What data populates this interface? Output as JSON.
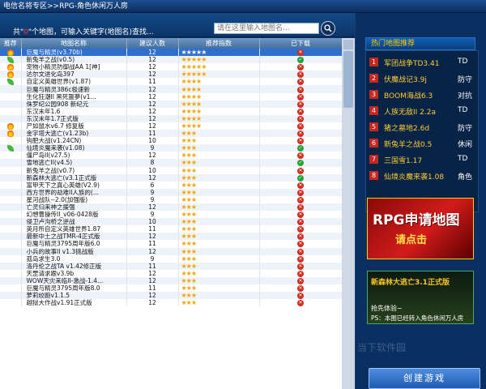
{
  "breadcrumb": "电信名将专区>>RPG-角色休闲万人房",
  "filter": {
    "count_prefix": "共\"",
    "count_value": "0",
    "count_suffix": "\"个地图，可输入关键字(地图名)查找...",
    "search_placeholder": "请在这里输入地图名..."
  },
  "table": {
    "headers": [
      "推荐",
      "地图名称",
      "建议人数",
      "推荐指数",
      "已下载"
    ],
    "rows": [
      {
        "icon": "hot",
        "name": "巨魔与精灵(v3.70b)",
        "players": "12",
        "stars": "★★★★★",
        "status": "no",
        "selected": true
      },
      {
        "icon": "leaf",
        "name": "新兔羊之战(v0.5)",
        "players": "12",
        "stars": "★★★★★",
        "status": "yes"
      },
      {
        "icon": "hot",
        "name": "宠物小精灵防御战AA 1[神]",
        "players": "12",
        "stars": "★★★★★",
        "status": "no"
      },
      {
        "icon": "hot",
        "name": "达尔文进化岛397",
        "players": "12",
        "stars": "★★★★★",
        "status": "no"
      },
      {
        "icon": "leaf",
        "name": "自定义英雄世界(v1.87)",
        "players": "11",
        "stars": "★★★★",
        "status": "no"
      },
      {
        "icon": "",
        "name": "巨魔与精灵386c极速新",
        "players": "12",
        "stars": "★★★★",
        "status": "no"
      },
      {
        "icon": "",
        "name": "生化狂潮II 黑死噩夢(v1...",
        "players": "12",
        "stars": "★★★★",
        "status": "no"
      },
      {
        "icon": "",
        "name": "侏罗纪公园908 新纪元",
        "players": "12",
        "stars": "★★★★",
        "status": "no"
      },
      {
        "icon": "",
        "name": "东汉末年1.6",
        "players": "12",
        "stars": "★★★★",
        "status": "no"
      },
      {
        "icon": "",
        "name": "东汉末年1.7正式版",
        "players": "12",
        "stars": "★★★★",
        "status": "no"
      },
      {
        "icon": "hot",
        "name": "尸如鼠水v6.7 修复版",
        "players": "12",
        "stars": "★★★★",
        "status": "no"
      },
      {
        "icon": "hot",
        "name": "金字塔大逃亡(v1.23b)",
        "players": "11",
        "stars": "★★★",
        "status": "no"
      },
      {
        "icon": "",
        "name": "钩肥大战(v1.24CN)",
        "players": "10",
        "stars": "★★★",
        "status": "no"
      },
      {
        "icon": "leaf",
        "name": "仙境炎魔来袭(v1.08)",
        "players": "9",
        "stars": "★★★",
        "status": "yes"
      },
      {
        "icon": "",
        "name": "僵尸岛II(v27.5)",
        "players": "12",
        "stars": "★★★",
        "status": "no"
      },
      {
        "icon": "",
        "name": "雪地逃亡II(v4.5)",
        "players": "8",
        "stars": "★★★",
        "status": "yes"
      },
      {
        "icon": "",
        "name": "新兔羊之战(v0.7)",
        "players": "10",
        "stars": "★★★",
        "status": "no"
      },
      {
        "icon": "",
        "name": "新森林大逃亡(v3.1正式版",
        "players": "12",
        "stars": "★★★",
        "status": "yes"
      },
      {
        "icon": "",
        "name": "富甲天下之真心英雄(V2.9)",
        "players": "6",
        "stars": "★★★",
        "status": "no"
      },
      {
        "icon": "",
        "name": "西方世界的劫难II人族的(...",
        "players": "9",
        "stars": "★★★",
        "status": "no"
      },
      {
        "icon": "",
        "name": "星河战队--2.0(加强版)",
        "players": "9",
        "stars": "★★★",
        "status": "no"
      },
      {
        "icon": "",
        "name": "亡灵归来神之援强",
        "players": "12",
        "stars": "★★★",
        "status": "no"
      },
      {
        "icon": "",
        "name": "幻想曹操传II_v06-0428版",
        "players": "9",
        "stars": "★★★",
        "status": "no"
      },
      {
        "icon": "",
        "name": "侵卫卢沟桥之逆战",
        "players": "10",
        "stars": "★★★",
        "status": "no"
      },
      {
        "icon": "",
        "name": "英月所自定义英雄世界1.87",
        "players": "11",
        "stars": "★★★",
        "status": "no"
      },
      {
        "icon": "",
        "name": "最新中土之战TMR-4正式版",
        "players": "12",
        "stars": "★★★",
        "status": "no"
      },
      {
        "icon": "",
        "name": "巨魔与精灵3795周年版6.0",
        "players": "11",
        "stars": "★★★",
        "status": "no"
      },
      {
        "icon": "",
        "name": "小兵的故事II v1.3挑战版",
        "players": "12",
        "stars": "★★★",
        "status": "no"
      },
      {
        "icon": "",
        "name": "孤岛求生3.0",
        "players": "9",
        "stars": "★★★",
        "status": "no"
      },
      {
        "icon": "",
        "name": "洛丹伦之战TA v1.42修正版",
        "players": "11",
        "stars": "★★★",
        "status": "no"
      },
      {
        "icon": "",
        "name": "天罡请求跟v3.9b",
        "players": "12",
        "stars": "★★★",
        "status": "no"
      },
      {
        "icon": "",
        "name": "WOW天灾来临II-激战-1.4...",
        "players": "12",
        "stars": "★★★",
        "status": "no"
      },
      {
        "icon": "",
        "name": "巨魔与精灵3795周年版8.0",
        "players": "11",
        "stars": "★★★",
        "status": "no"
      },
      {
        "icon": "",
        "name": "萝莉绞跑v1.1.5",
        "players": "12",
        "stars": "★★★",
        "status": "no"
      },
      {
        "icon": "",
        "name": "越狱大作战v1.91正式版",
        "players": "12",
        "stars": "★★★",
        "status": "no"
      }
    ]
  },
  "hot": {
    "title": "热门地图推荐",
    "items": [
      {
        "num": "1",
        "name": "军团战争TD3.41",
        "tag": "TD"
      },
      {
        "num": "2",
        "name": "伏魔战记3.9j",
        "tag": "防守"
      },
      {
        "num": "3",
        "name": "BOOM海战6.3",
        "tag": "对抗"
      },
      {
        "num": "4",
        "name": "人族无敌II 2.2a",
        "tag": "TD"
      },
      {
        "num": "5",
        "name": "猪之墓地2.6d",
        "tag": "防守"
      },
      {
        "num": "6",
        "name": "新兔羊之战0.5",
        "tag": "休闲"
      },
      {
        "num": "7",
        "name": "三国雪1.17",
        "tag": "TD"
      },
      {
        "num": "8",
        "name": "仙境炎魔来袭1.08",
        "tag": "角色"
      }
    ]
  },
  "banner1": {
    "title": "RPG申请地图",
    "subtitle": "请点击"
  },
  "banner2": {
    "title": "新森林大逃亡3.1正式版",
    "line1": "抢先体验~",
    "line2": "PS：本图已经转入角色休闲万人房"
  },
  "watermark": "当下软件园",
  "create_button": "创建游戏"
}
